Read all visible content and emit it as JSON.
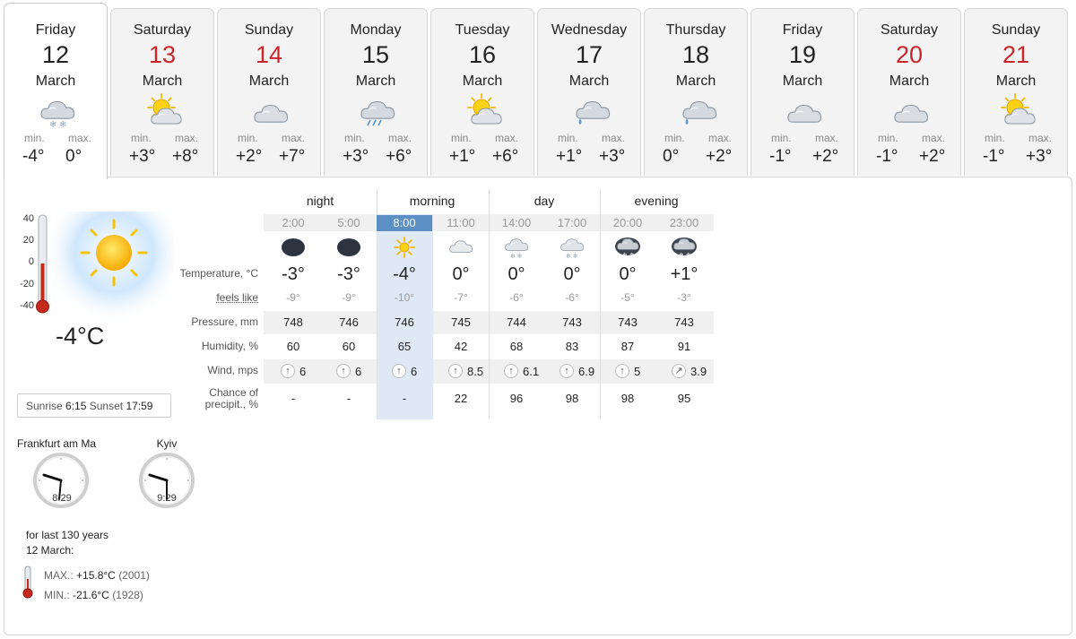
{
  "days": [
    {
      "name": "Friday",
      "num": "12",
      "month": "March",
      "weekend": false,
      "icon": "cloud-snow-icon",
      "min_label": "min.",
      "max_label": "max.",
      "min": "-4°",
      "max": "0°",
      "active": true
    },
    {
      "name": "Saturday",
      "num": "13",
      "month": "March",
      "weekend": true,
      "icon": "sun-cloud-icon",
      "min_label": "min.",
      "max_label": "max.",
      "min": "+3°",
      "max": "+8°",
      "active": false
    },
    {
      "name": "Sunday",
      "num": "14",
      "month": "March",
      "weekend": true,
      "icon": "cloud-icon",
      "min_label": "min.",
      "max_label": "max.",
      "min": "+2°",
      "max": "+7°",
      "active": false
    },
    {
      "name": "Monday",
      "num": "15",
      "month": "March",
      "weekend": false,
      "icon": "cloud-rain-icon",
      "min_label": "min.",
      "max_label": "max.",
      "min": "+3°",
      "max": "+6°",
      "active": false
    },
    {
      "name": "Tuesday",
      "num": "16",
      "month": "March",
      "weekend": false,
      "icon": "sun-cloud-icon",
      "min_label": "min.",
      "max_label": "max.",
      "min": "+1°",
      "max": "+6°",
      "active": false
    },
    {
      "name": "Wednesday",
      "num": "17",
      "month": "March",
      "weekend": false,
      "icon": "cloud-drizzle-icon",
      "min_label": "min.",
      "max_label": "max.",
      "min": "+1°",
      "max": "+3°",
      "active": false
    },
    {
      "name": "Thursday",
      "num": "18",
      "month": "March",
      "weekend": false,
      "icon": "cloud-drizzle-icon",
      "min_label": "min.",
      "max_label": "max.",
      "min": "0°",
      "max": "+2°",
      "active": false
    },
    {
      "name": "Friday",
      "num": "19",
      "month": "March",
      "weekend": false,
      "icon": "cloud-icon",
      "min_label": "min.",
      "max_label": "max.",
      "min": "-1°",
      "max": "+2°",
      "active": false
    },
    {
      "name": "Saturday",
      "num": "20",
      "month": "March",
      "weekend": true,
      "icon": "cloud-icon",
      "min_label": "min.",
      "max_label": "max.",
      "min": "-1°",
      "max": "+2°",
      "active": false
    },
    {
      "name": "Sunday",
      "num": "21",
      "month": "March",
      "weekend": true,
      "icon": "sun-cloud-icon",
      "min_label": "min.",
      "max_label": "max.",
      "min": "-1°",
      "max": "+3°",
      "active": false
    }
  ],
  "current": {
    "temp": "-4°C",
    "scale": [
      "40",
      "20",
      "0",
      "-20",
      "-40"
    ],
    "sunrise_label": "Sunrise",
    "sunrise": "6:15",
    "sunset_label": "Sunset",
    "sunset": "17:59"
  },
  "clocks": [
    {
      "city": "Frankfurt am Ma",
      "time": "8:29"
    },
    {
      "city": "Kyiv",
      "time": "9:29"
    }
  ],
  "history": {
    "line1": "for last 130 years",
    "line2": "12 March:",
    "max_label": "MAX.:",
    "max_value": "+15.8°C",
    "max_year": "(2001)",
    "min_label": "MIN.:",
    "min_value": "-21.6°C",
    "min_year": "(1928)"
  },
  "periods": [
    "night",
    "morning",
    "day",
    "evening"
  ],
  "hours": [
    "2:00",
    "5:00",
    "8:00",
    "11:00",
    "14:00",
    "17:00",
    "20:00",
    "23:00"
  ],
  "hour_icons": [
    "moon-cloud-icon",
    "moon-cloud-icon",
    "sun-icon",
    "cloud-icon",
    "cloud-snow-icon",
    "cloud-snow-icon",
    "cloud-storm-icon",
    "cloud-storm-icon"
  ],
  "row_labels": {
    "temperature": "Temperature, °C",
    "feels": "feels like",
    "pressure": "Pressure, mm",
    "humidity": "Humidity, %",
    "wind": "Wind, mps",
    "precip1": "Chance of",
    "precip2": "precipit., %"
  },
  "temperature": [
    "-3°",
    "-3°",
    "-4°",
    "0°",
    "0°",
    "0°",
    "0°",
    "+1°"
  ],
  "feels": [
    "-9°",
    "-9°",
    "-10°",
    "-7°",
    "-6°",
    "-6°",
    "-5°",
    "-3°"
  ],
  "pressure": [
    "748",
    "746",
    "746",
    "745",
    "744",
    "743",
    "743",
    "743"
  ],
  "humidity": [
    "60",
    "60",
    "65",
    "42",
    "68",
    "83",
    "87",
    "91"
  ],
  "wind": [
    "6",
    "6",
    "6",
    "8.5",
    "6.1",
    "6.9",
    "5",
    "3.9"
  ],
  "wind_dir": [
    "↑",
    "↑",
    "↑",
    "↑",
    "↑",
    "↑",
    "↑",
    "↗"
  ],
  "precip": [
    "-",
    "-",
    "-",
    "22",
    "96",
    "98",
    "98",
    "95"
  ]
}
